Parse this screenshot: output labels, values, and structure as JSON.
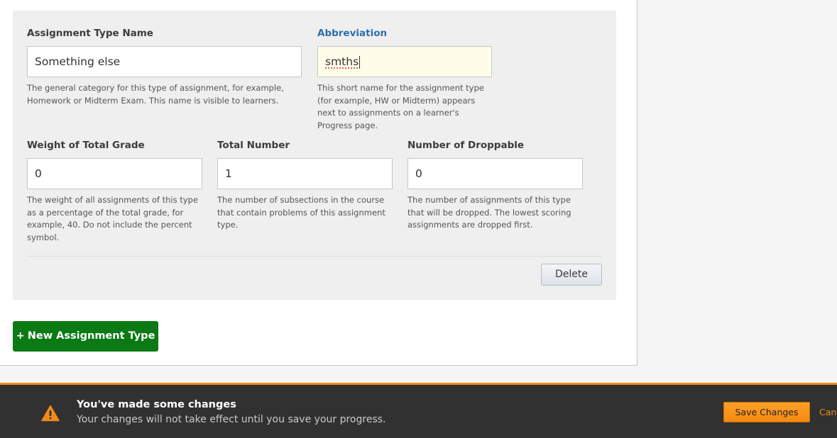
{
  "assignment_type": {
    "name": {
      "label": "Assignment Type Name",
      "value": "Something else",
      "help": "The general category for this type of assignment, for example, Homework or Midterm Exam. This name is visible to learners."
    },
    "abbreviation": {
      "label": "Abbreviation",
      "value": "smths",
      "help": "This short name for the assignment type (for example, HW or Midterm) appears next to assignments on a learner's Progress page."
    },
    "weight": {
      "label": "Weight of Total Grade",
      "value": "0",
      "help": "The weight of all assignments of this type as a percentage of the total grade, for example, 40. Do not include the percent symbol."
    },
    "total_number": {
      "label": "Total Number",
      "value": "1",
      "help": "The number of subsections in the course that contain problems of this assignment type."
    },
    "droppable": {
      "label": "Number of Droppable",
      "value": "0",
      "help": "The number of assignments of this type that will be dropped. The lowest scoring assignments are dropped first."
    },
    "delete_label": "Delete"
  },
  "new_assignment": {
    "icon": "+",
    "label": "New Assignment Type"
  },
  "notification": {
    "icon": "warning-icon",
    "title": "You've made some changes",
    "message": "Your changes will not take effect until you save your progress.",
    "save_label": "Save Changes",
    "cancel_label": "Cancel"
  },
  "colors": {
    "accent_orange": "#f08a1c",
    "new_button_green": "#0b7a14",
    "focused_label_blue": "#2f6fb0"
  }
}
